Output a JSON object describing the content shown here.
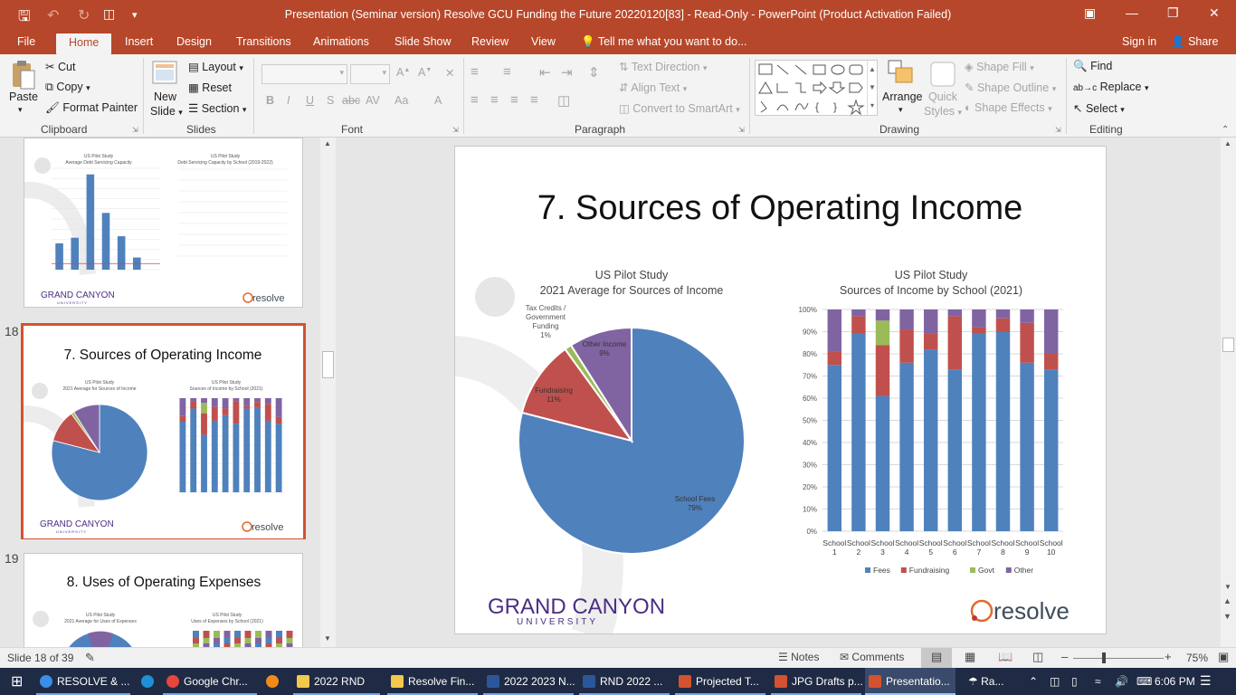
{
  "titlebar": {
    "title": "Presentation (Seminar version) Resolve GCU Funding the Future 20220120[83]  -  Read-Only - PowerPoint (Product Activation Failed)"
  },
  "tabs": [
    "File",
    "Home",
    "Insert",
    "Design",
    "Transitions",
    "Animations",
    "Slide Show",
    "Review",
    "View"
  ],
  "tell_me": "Tell me what you want to do...",
  "signin": "Sign in",
  "share": "Share",
  "ribbon": {
    "clipboard": {
      "paste": "Paste",
      "cut": "Cut",
      "copy": "Copy",
      "format_painter": "Format Painter",
      "label": "Clipboard"
    },
    "slides": {
      "new_slide": "New",
      "new_slide2": "Slide",
      "layout": "Layout",
      "reset": "Reset",
      "section": "Section",
      "label": "Slides"
    },
    "font": {
      "label": "Font"
    },
    "paragraph": {
      "text_direction": "Text Direction",
      "align_text": "Align Text",
      "convert_smartart": "Convert to SmartArt",
      "label": "Paragraph"
    },
    "drawing": {
      "arrange": "Arrange",
      "quick": "Quick",
      "styles": "Styles",
      "shape_fill": "Shape Fill",
      "shape_outline": "Shape Outline",
      "shape_effects": "Shape Effects",
      "label": "Drawing"
    },
    "editing": {
      "find": "Find",
      "replace": "Replace",
      "select": "Select",
      "label": "Editing"
    }
  },
  "thumbnails": {
    "t17": {
      "left_title": "US Pilot Study",
      "left_sub": "Average Debt Servicing Capacity",
      "right_title": "US Pilot Study",
      "right_sub": "Debt Servicing Capacity by School (2019-2022)",
      "values": [
        5.2,
        6.3,
        18.8,
        11.2,
        6.6,
        2.4,
        0
      ]
    },
    "t18": {
      "number": "18",
      "title": "7. Sources of Operating Income"
    },
    "t19": {
      "number": "19",
      "title": "8. Uses of Operating Expenses",
      "left_title": "US Pilot Study",
      "left_sub": "2021 Average for Uses of Expenses",
      "right_title": "US Pilot Study",
      "right_sub": "Uses of Expenses by School (2021)"
    },
    "gcu_logo": "GRAND CANYON",
    "gcu_sub": "UNIVERSITY",
    "resolve": "resolve"
  },
  "slide": {
    "title": "7. Sources of Operating Income",
    "logo_left": "GRAND CANYON",
    "logo_left_sub": "UNIVERSITY",
    "logo_right": "resolve"
  },
  "chart_data": [
    {
      "type": "pie",
      "title": "US Pilot Study",
      "subtitle": "2021 Average for Sources of Income",
      "categories": [
        "School Fees",
        "Fundraising",
        "Tax Credits / Government Funding",
        "Other Income"
      ],
      "values": [
        79,
        11,
        1,
        9
      ],
      "labels": [
        "School Fees\n79%",
        "Fundraising\n11%",
        "Tax Credits /\nGovernment\nFunding\n1%",
        "Other Income\n9%"
      ],
      "colors": [
        "#4f81bd",
        "#c0504d",
        "#9bbb59",
        "#8064a2"
      ]
    },
    {
      "type": "bar",
      "stacked": true,
      "title": "US Pilot Study",
      "subtitle": "Sources of Income by School (2021)",
      "categories": [
        "School 1",
        "School 2",
        "School 3",
        "School 4",
        "School 5",
        "School 6",
        "School 7",
        "School 8",
        "School 9",
        "School 10"
      ],
      "series": [
        {
          "name": "Fees",
          "color": "#4f81bd",
          "values": [
            75,
            89,
            61,
            76,
            82,
            73,
            89,
            90,
            76,
            73
          ]
        },
        {
          "name": "Fundraising",
          "color": "#c0504d",
          "values": [
            6,
            8,
            23,
            15,
            7,
            24,
            3,
            6,
            18,
            7
          ]
        },
        {
          "name": "Govt",
          "color": "#9bbb59",
          "values": [
            0,
            0,
            11,
            0,
            0,
            0,
            0,
            0,
            0,
            0
          ]
        },
        {
          "name": "Other",
          "color": "#8064a2",
          "values": [
            19,
            3,
            5,
            9,
            11,
            3,
            8,
            4,
            6,
            20
          ]
        }
      ],
      "ylim": [
        0,
        100
      ],
      "yticks": [
        "0%",
        "10%",
        "20%",
        "30%",
        "40%",
        "50%",
        "60%",
        "70%",
        "80%",
        "90%",
        "100%"
      ],
      "legend": "bottom"
    }
  ],
  "status": {
    "slide": "Slide 18 of 39",
    "notes": "Notes",
    "comments": "Comments",
    "zoom": "75%"
  },
  "taskbar": {
    "apps": [
      "RESOLVE & ...",
      "Google Chr...",
      "2022 RND",
      "Resolve Fin...",
      "2022 2023 N...",
      "RND 2022 ...",
      "Projected T...",
      "JPG Drafts p...",
      "Presentatio..."
    ],
    "weather": "Ra...",
    "time": "6:06 PM"
  }
}
